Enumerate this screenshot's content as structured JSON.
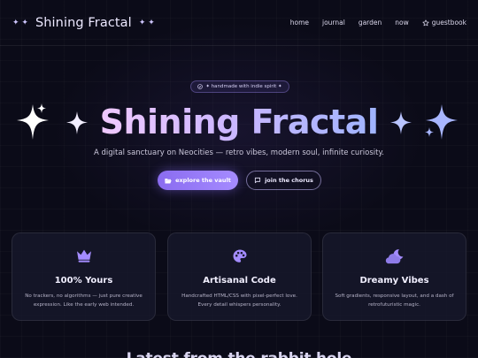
{
  "header": {
    "brand": "Shining Fractal",
    "nav": [
      "home",
      "journal",
      "garden",
      "now",
      "guestbook"
    ]
  },
  "hero": {
    "badge": "✦ handmade with indie spirit ✦",
    "title": "Shining Fractal",
    "tagline": "A digital sanctuary on Neocities — retro vibes, modern soul, infinite curiosity.",
    "primary_button": "explore the vault",
    "secondary_button": "join the chorus"
  },
  "features": [
    {
      "icon": "crown-icon",
      "title": "100% Yours",
      "line1": "No trackers, no algorithms — just pure creative",
      "line2": "expression. Like the early web intended."
    },
    {
      "icon": "palette-icon",
      "title": "Artisanal Code",
      "line1": "Handcrafted HTML/CSS with pixel-perfect love.",
      "line2": "Every detail whispers personality."
    },
    {
      "icon": "moon-cloud-icon",
      "title": "Dreamy Vibes",
      "line1": "Soft gradients, responsive layout, and a dash of",
      "line2": "retrofuturistic magic."
    }
  ],
  "section": {
    "heading": "Latest from the rabbit hole"
  },
  "colors": {
    "accent": "#8a6cf0",
    "icon": "#a48cff",
    "background": "#0b0b18"
  }
}
